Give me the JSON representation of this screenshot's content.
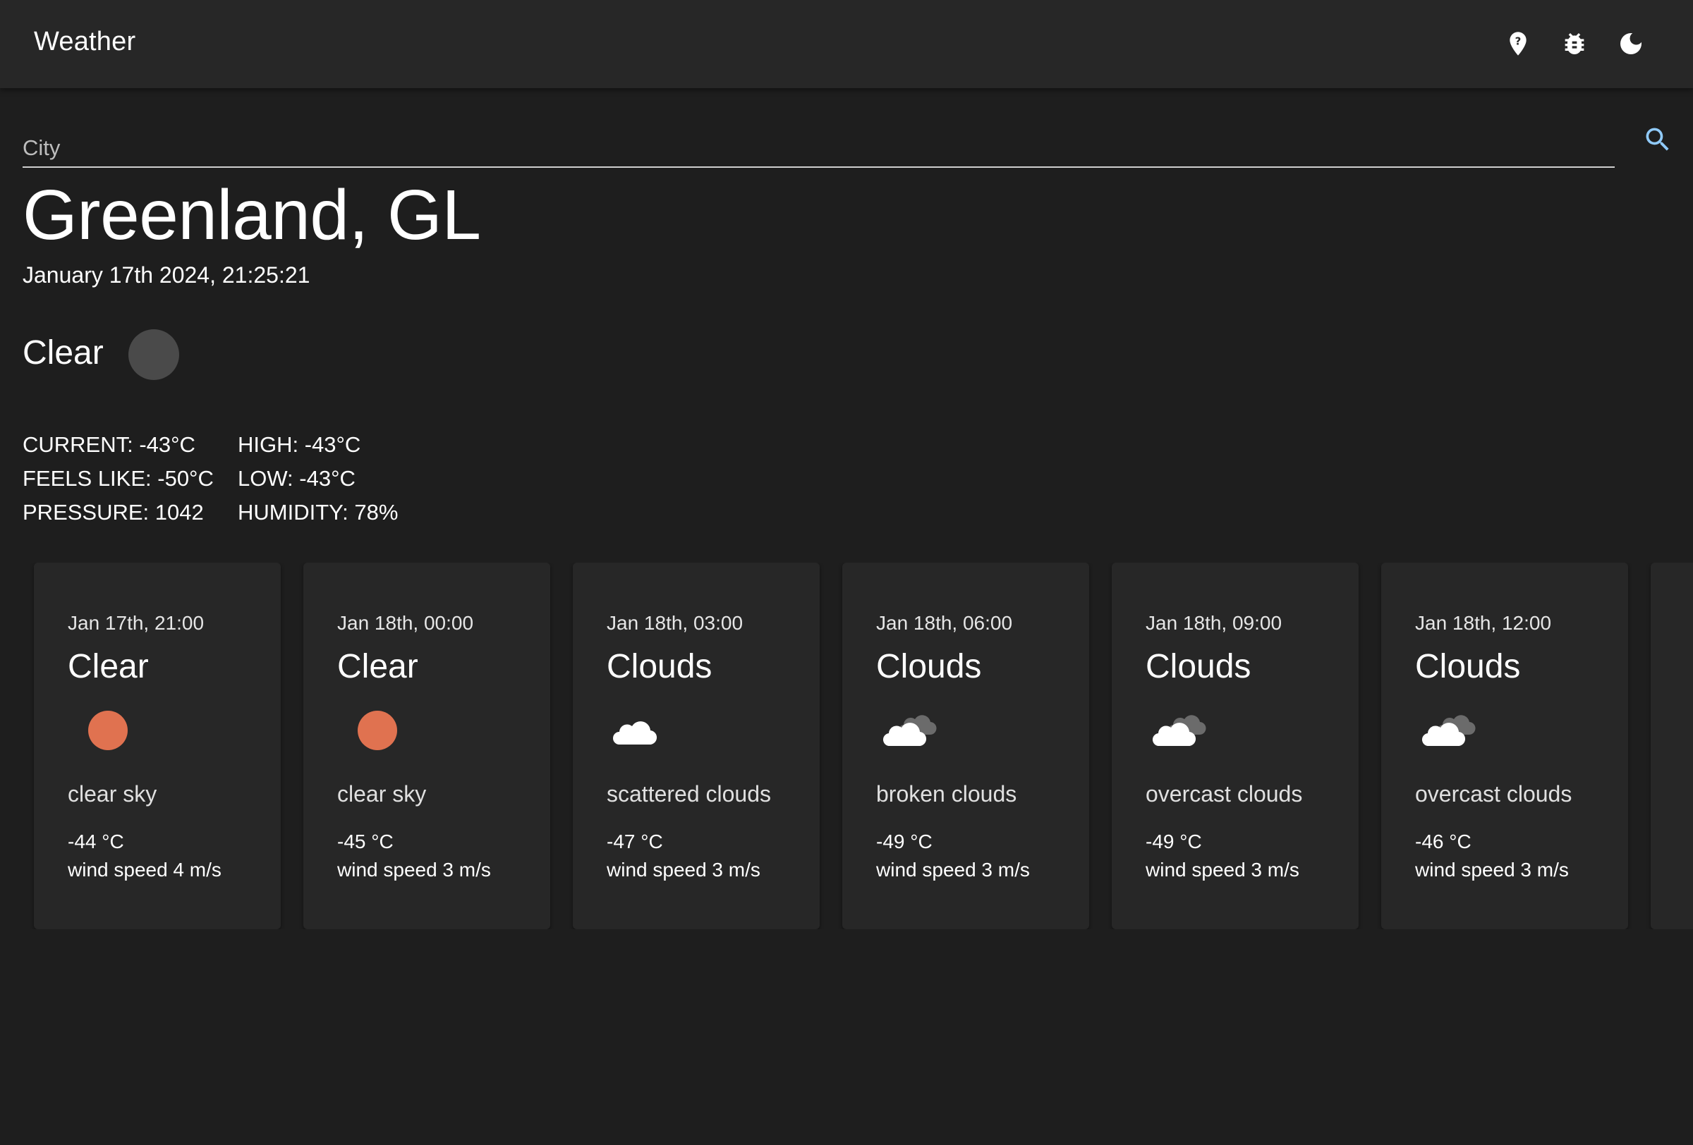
{
  "appbar": {
    "title": "Weather",
    "icons": [
      "help-location-icon",
      "bug-icon",
      "dark-mode-icon"
    ]
  },
  "search": {
    "placeholder": "City",
    "value": "",
    "icon": "search-icon",
    "accent_color": "#90caf9"
  },
  "current": {
    "location": "Greenland, GL",
    "datetime": "January 17th 2024, 21:25:21",
    "condition": "Clear",
    "stats": {
      "current": "CURRENT: -43°C",
      "high": "HIGH: -43°C",
      "feels_like": "FEELS LIKE: -50°C",
      "low": "LOW: -43°C",
      "pressure": "PRESSURE: 1042",
      "humidity": "HUMIDITY: 78%"
    }
  },
  "forecast": [
    {
      "date": "Jan 17th, 21:00",
      "main": "Clear",
      "icon": "sun-icon",
      "description": "clear sky",
      "temp": "-44 °C",
      "wind": "wind speed 4 m/s"
    },
    {
      "date": "Jan 18th, 00:00",
      "main": "Clear",
      "icon": "sun-icon",
      "description": "clear sky",
      "temp": "-45 °C",
      "wind": "wind speed 3 m/s"
    },
    {
      "date": "Jan 18th, 03:00",
      "main": "Clouds",
      "icon": "cloud-icon",
      "description": "scattered clouds",
      "temp": "-47 °C",
      "wind": "wind speed 3 m/s"
    },
    {
      "date": "Jan 18th, 06:00",
      "main": "Clouds",
      "icon": "clouds-icon",
      "description": "broken clouds",
      "temp": "-49 °C",
      "wind": "wind speed 3 m/s"
    },
    {
      "date": "Jan 18th, 09:00",
      "main": "Clouds",
      "icon": "clouds-icon",
      "description": "overcast clouds",
      "temp": "-49 °C",
      "wind": "wind speed 3 m/s"
    },
    {
      "date": "Jan 18th, 12:00",
      "main": "Clouds",
      "icon": "clouds-icon",
      "description": "overcast clouds",
      "temp": "-46 °C",
      "wind": "wind speed 3 m/s"
    }
  ],
  "colors": {
    "background": "#1e1e1e",
    "appbar": "#272727",
    "card": "#272727",
    "sun": "#e07250"
  }
}
